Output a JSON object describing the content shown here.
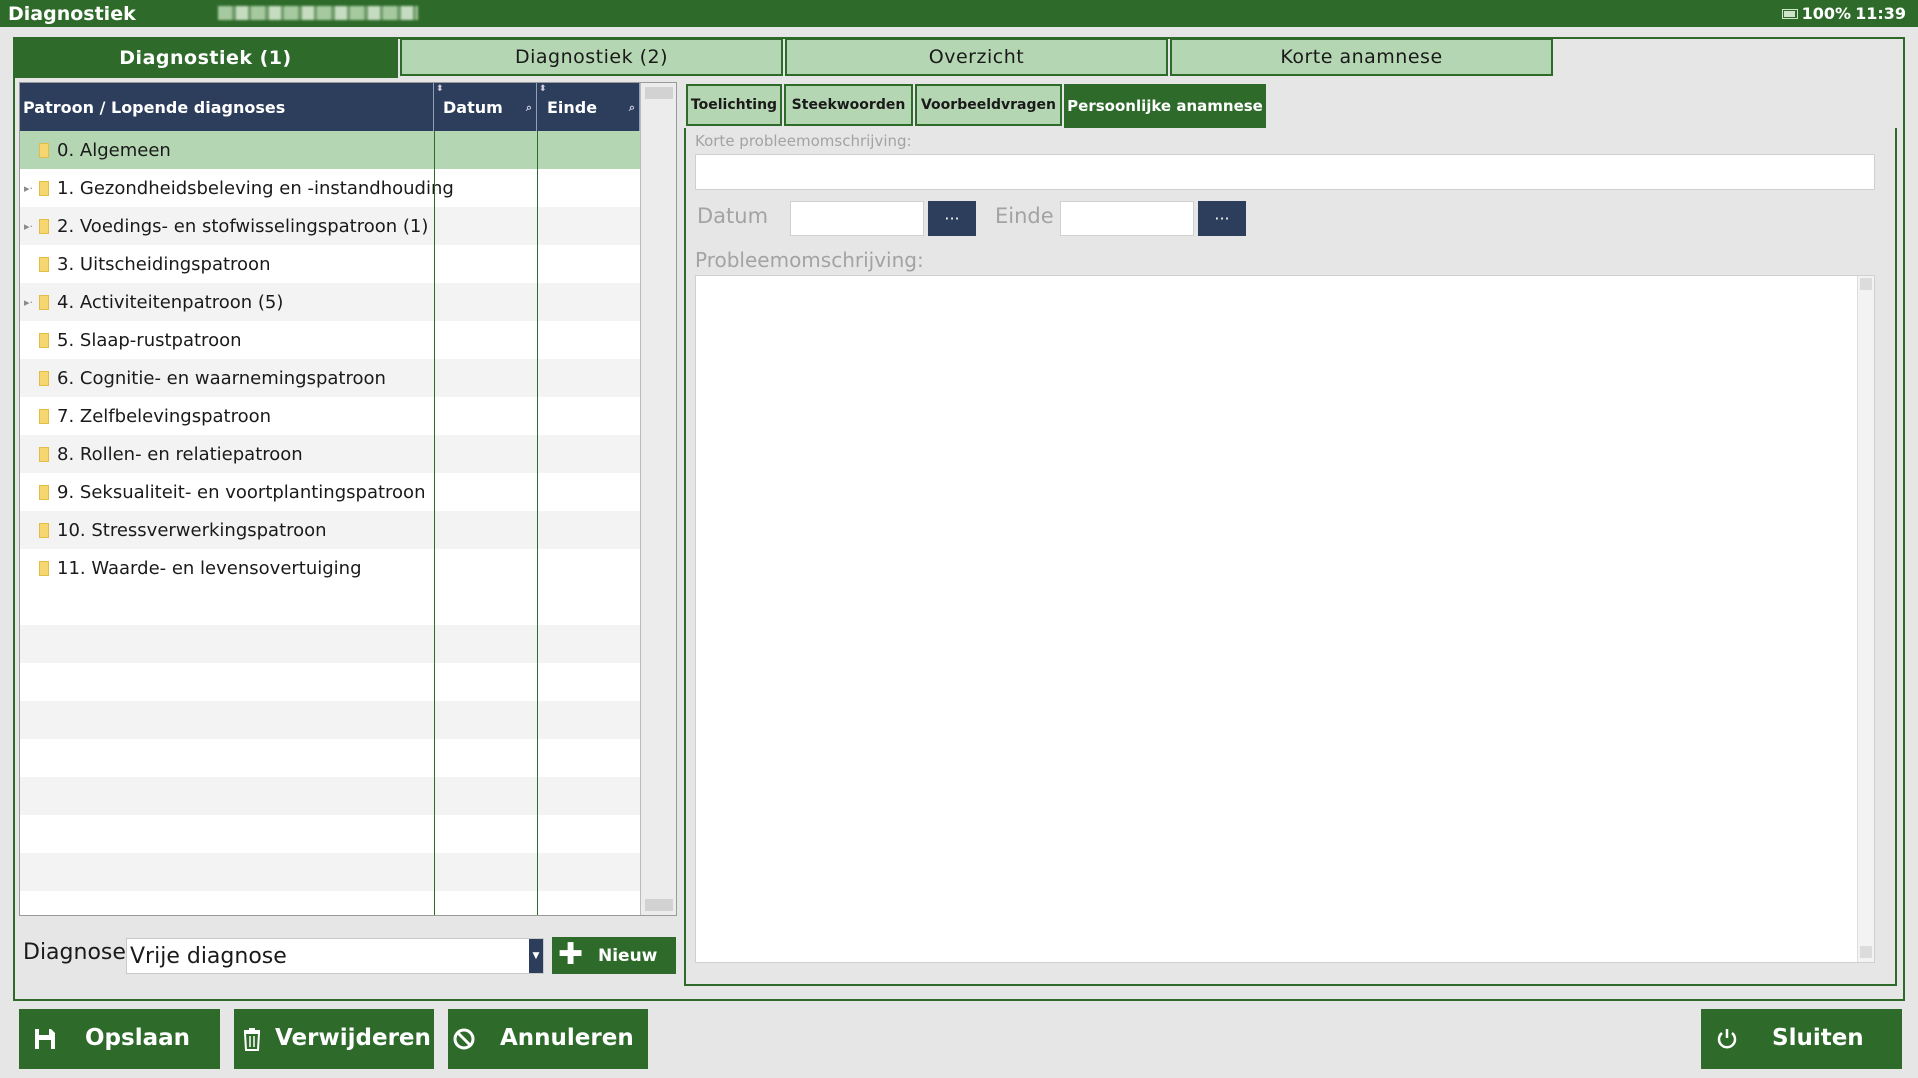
{
  "titlebar": {
    "app_title": "Diagnostiek",
    "zoom": "100%",
    "time": "11:39"
  },
  "main_tabs": [
    {
      "label": "Diagnostiek (1)",
      "active": true
    },
    {
      "label": "Diagnostiek (2)",
      "active": false
    },
    {
      "label": "Overzicht",
      "active": false
    },
    {
      "label": "Korte anamnese",
      "active": false
    }
  ],
  "list": {
    "columns": {
      "pattern": "Patroon / Lopende diagnoses",
      "date": "Datum",
      "end": "Einde"
    },
    "rows": [
      {
        "label": "0. Algemeen",
        "expandable": false,
        "selected": true
      },
      {
        "label": "1. Gezondheidsbeleving en -instandhouding",
        "expandable": true,
        "selected": false
      },
      {
        "label": "2. Voedings- en stofwisselingspatroon (1)",
        "expandable": true,
        "selected": false
      },
      {
        "label": "3. Uitscheidingspatroon",
        "expandable": false,
        "selected": false
      },
      {
        "label": "4. Activiteitenpatroon (5)",
        "expandable": true,
        "selected": false
      },
      {
        "label": "5. Slaap-rustpatroon",
        "expandable": false,
        "selected": false
      },
      {
        "label": "6. Cognitie- en waarnemingspatroon",
        "expandable": false,
        "selected": false
      },
      {
        "label": "7. Zelfbelevingspatroon",
        "expandable": false,
        "selected": false
      },
      {
        "label": "8. Rollen- en relatiepatroon",
        "expandable": false,
        "selected": false
      },
      {
        "label": "9. Seksualiteit- en voortplantingspatroon",
        "expandable": false,
        "selected": false
      },
      {
        "label": "10. Stressverwerkingspatroon",
        "expandable": false,
        "selected": false
      },
      {
        "label": "11. Waarde- en levensovertuiging",
        "expandable": false,
        "selected": false
      }
    ]
  },
  "diagnose": {
    "label": "Diagnose",
    "selected": "Vrije diagnose",
    "new_button": "Nieuw"
  },
  "sub_tabs": [
    {
      "label": "Toelichting",
      "active": false
    },
    {
      "label": "Steekwoorden",
      "active": false
    },
    {
      "label": "Voorbeeldvragen",
      "active": false
    },
    {
      "label": "Persoonlijke anamnese",
      "active": true
    }
  ],
  "form": {
    "short_desc_label": "Korte probleemomschrijving:",
    "short_desc_value": "",
    "date_label": "Datum",
    "date_value": "",
    "date_button": "···",
    "end_label": "Einde",
    "end_value": "",
    "end_button": "···",
    "desc_label": "Probleemomschrijving:",
    "desc_value": ""
  },
  "buttons": {
    "save": "Opslaan",
    "delete": "Verwijderen",
    "cancel": "Annuleren",
    "close": "Sluiten"
  },
  "colors": {
    "green": "#2e6b2a",
    "light_green": "#b5d6b2",
    "navy": "#2c3e5c"
  },
  "icons": {
    "save": "floppy-disk-icon",
    "delete": "trash-icon",
    "cancel": "no-entry-icon",
    "close": "power-icon",
    "add": "plus-icon",
    "folder": "folder-icon"
  }
}
